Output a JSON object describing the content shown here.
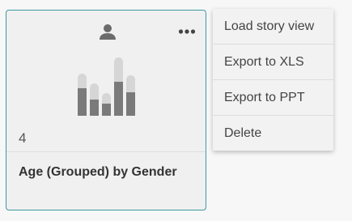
{
  "card": {
    "count": "4",
    "title": "Age (Grouped) by Gender",
    "owner_icon": "user-icon",
    "more_icon": "more-horizontal-icon",
    "thumbnail_icon": "bar-chart-icon",
    "accent_color": "#3d9aa0"
  },
  "menu": {
    "items": [
      {
        "label": "Load story view"
      },
      {
        "label": "Export to XLS"
      },
      {
        "label": "Export to PPT"
      },
      {
        "label": "Delete"
      }
    ]
  }
}
